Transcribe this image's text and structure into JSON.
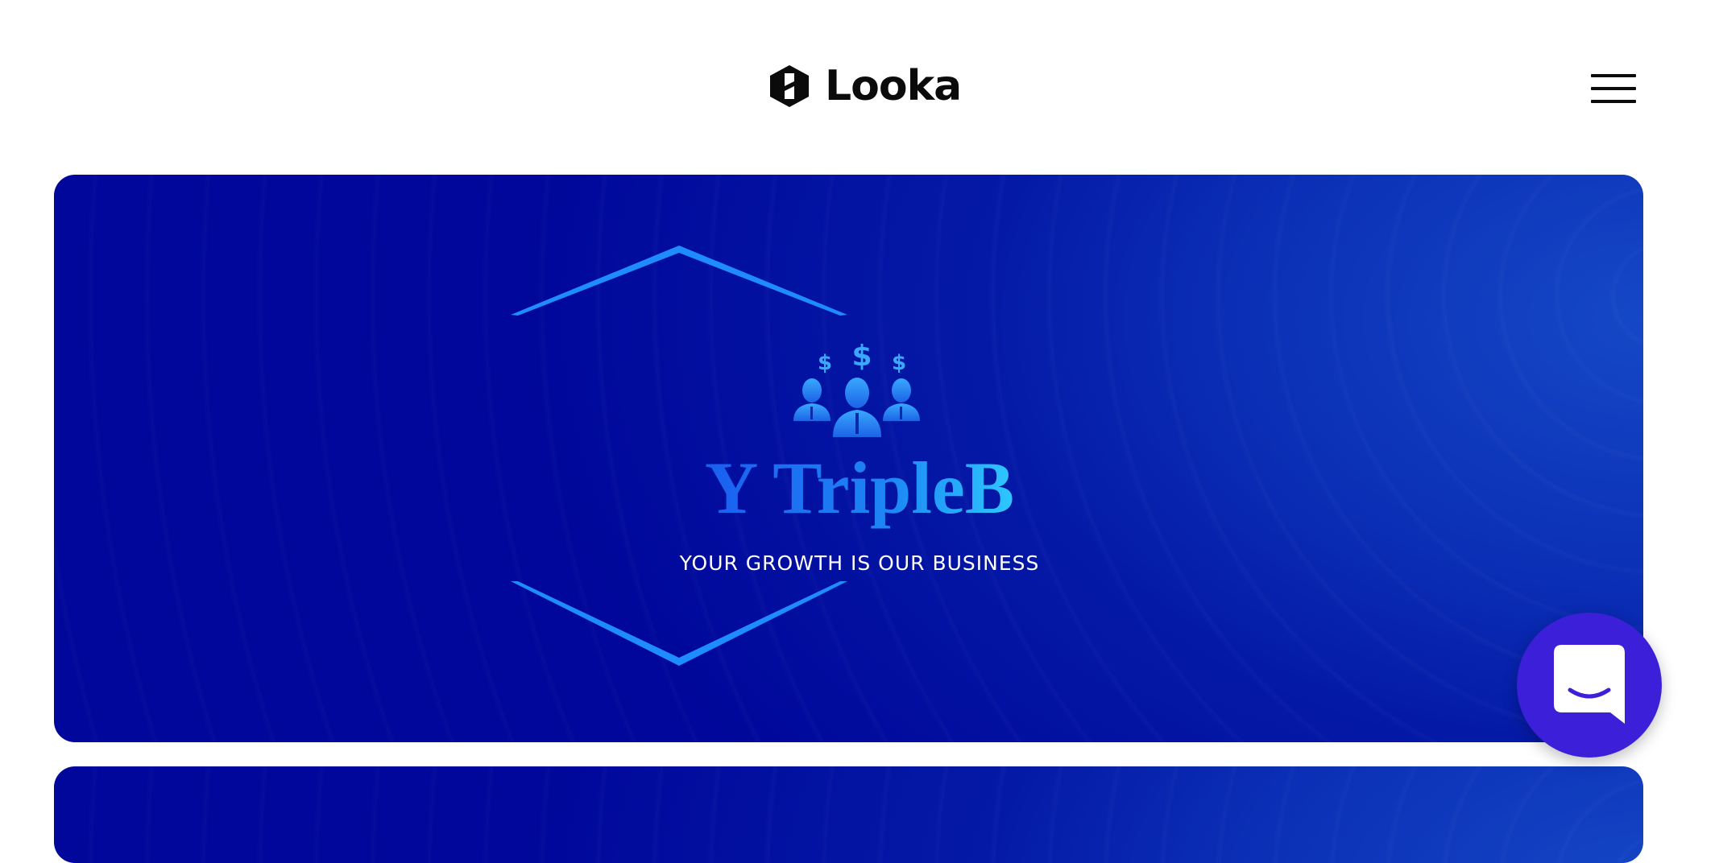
{
  "header": {
    "brand_name": "Looka",
    "logo_icon": "looka-logo-icon",
    "menu_icon": "hamburger-menu-icon"
  },
  "hero_card": {
    "brand_name": "Y TripleB",
    "tagline": "YOUR GROWTH IS OUR BUSINESS",
    "symbol_icon": "business-people-dollar-icon",
    "dollar_signs": [
      "$",
      "$",
      "$"
    ]
  },
  "chat": {
    "icon": "chat-bubble-icon"
  },
  "colors": {
    "card_dark": "#00079a",
    "card_light": "#1548c6",
    "logo_blue": "#1f7cf0",
    "logo_cyan": "#2ec8ff",
    "chat_purple": "#3b1fd9"
  }
}
